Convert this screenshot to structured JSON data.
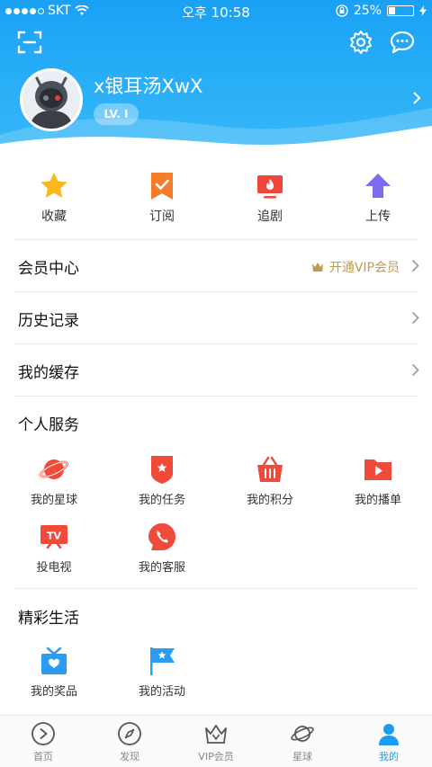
{
  "status_bar": {
    "carrier": "SKT",
    "time": "오후 10:58",
    "battery": "25%",
    "battery_level": 0.25
  },
  "profile": {
    "username": "x银耳汤XwX",
    "level": "LV. I"
  },
  "quick_actions": [
    {
      "label": "收藏",
      "icon": "star-icon"
    },
    {
      "label": "订阅",
      "icon": "bookmark-check-icon"
    },
    {
      "label": "追剧",
      "icon": "tv-fire-icon"
    },
    {
      "label": "上传",
      "icon": "upload-arrow-icon"
    }
  ],
  "menu": {
    "member_center": "会员中心",
    "vip_open": "开通VIP会员",
    "history": "历史记录",
    "cache": "我的缓存"
  },
  "personal_services": {
    "title": "个人服务",
    "items": [
      {
        "label": "我的星球",
        "icon": "planet-icon"
      },
      {
        "label": "我的任务",
        "icon": "task-shield-icon"
      },
      {
        "label": "我的积分",
        "icon": "basket-icon"
      },
      {
        "label": "我的播单",
        "icon": "playlist-folder-icon"
      },
      {
        "label": "投电视",
        "icon": "tv-cast-icon"
      },
      {
        "label": "我的客服",
        "icon": "phone-service-icon"
      }
    ]
  },
  "wonderful_life": {
    "title": "精彩生活",
    "items": [
      {
        "label": "我的奖品",
        "icon": "gift-icon"
      },
      {
        "label": "我的活动",
        "icon": "flag-icon"
      }
    ]
  },
  "bottom_nav": [
    {
      "label": "首页",
      "icon": "home-play-icon",
      "active": false
    },
    {
      "label": "发现",
      "icon": "compass-icon",
      "active": false
    },
    {
      "label": "VIP会员",
      "icon": "crown-icon",
      "active": false
    },
    {
      "label": "星球",
      "icon": "planet-outline-icon",
      "active": false
    },
    {
      "label": "我的",
      "icon": "person-icon",
      "active": true
    }
  ],
  "colors": {
    "accent": "#1c9cf0",
    "header": "#2bb0f7",
    "vip_gold": "#c09a50",
    "service_red": "#f04a3a"
  }
}
